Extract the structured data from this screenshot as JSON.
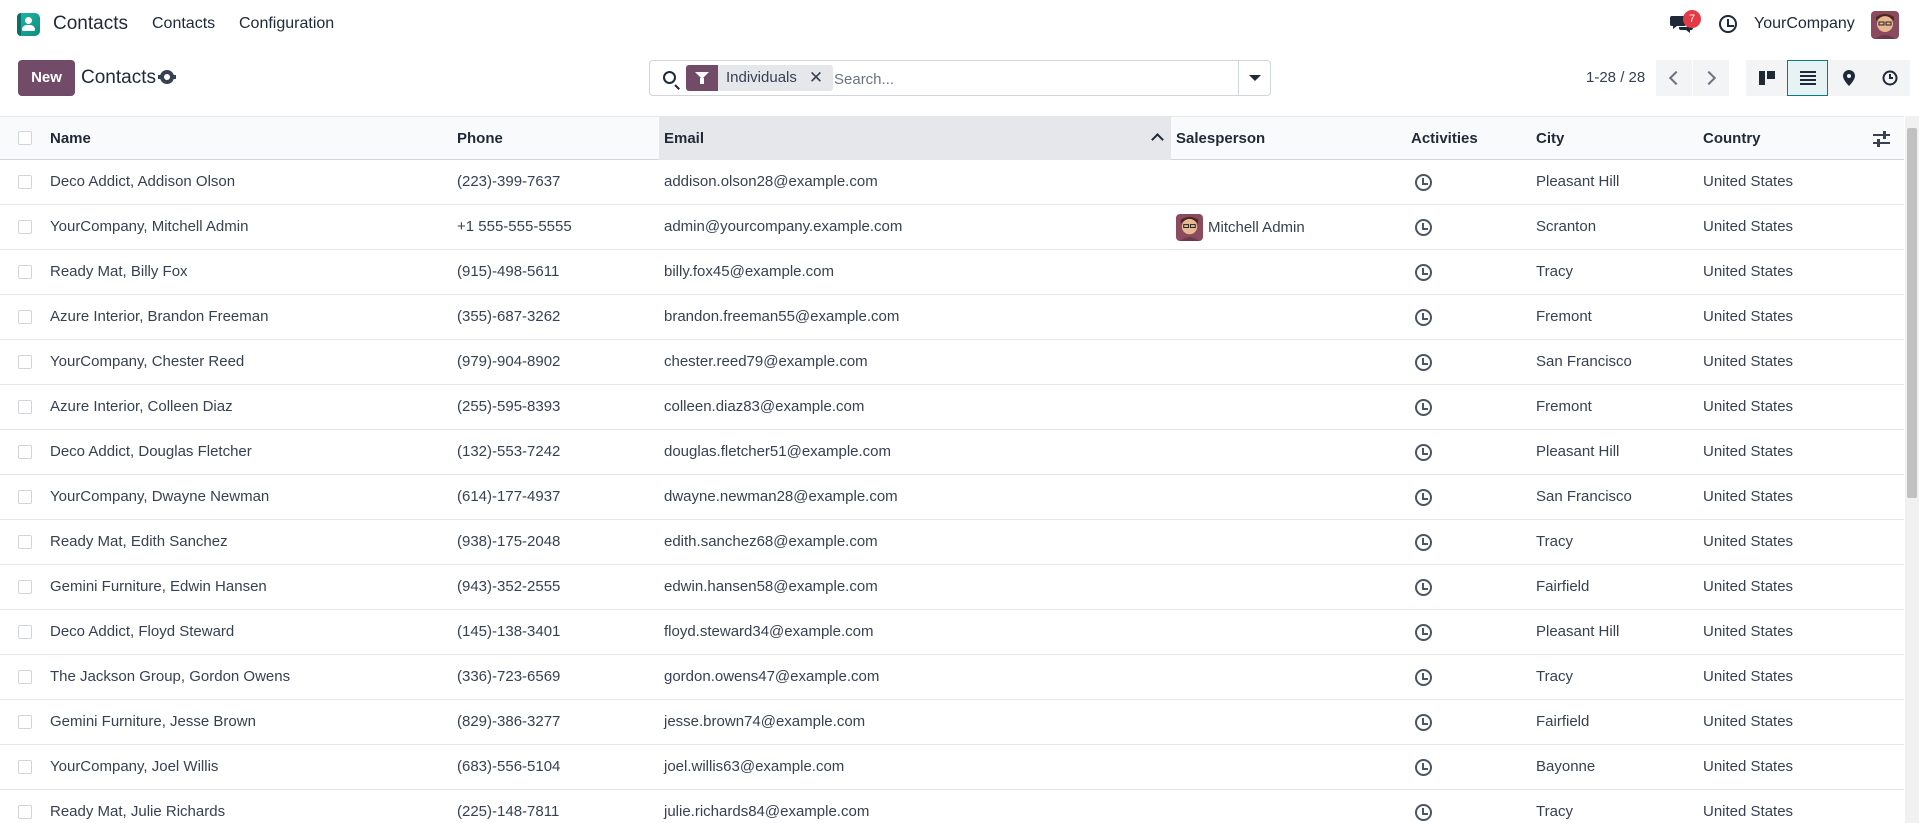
{
  "navbar": {
    "app_name": "Contacts",
    "menu": [
      "Contacts",
      "Configuration"
    ],
    "message_count": "7",
    "company": "YourCompany"
  },
  "control_panel": {
    "new_label": "New",
    "breadcrumb": "Contacts",
    "search": {
      "facet": "Individuals",
      "facet_remove": "✕",
      "placeholder": "Search...",
      "value": ""
    },
    "pager": "1-28 / 28"
  },
  "table": {
    "columns": [
      "Name",
      "Phone",
      "Email",
      "Salesperson",
      "Activities",
      "City",
      "Country"
    ],
    "rows": [
      {
        "name": "Deco Addict, Addison Olson",
        "phone": "(223)-399-7637",
        "email": "addison.olson28@example.com",
        "salesperson": "",
        "city": "Pleasant Hill",
        "country": "United States"
      },
      {
        "name": "YourCompany, Mitchell Admin",
        "phone": "+1 555-555-5555",
        "email": "admin@yourcompany.example.com",
        "salesperson": "Mitchell Admin",
        "city": "Scranton",
        "country": "United States"
      },
      {
        "name": "Ready Mat, Billy Fox",
        "phone": "(915)-498-5611",
        "email": "billy.fox45@example.com",
        "salesperson": "",
        "city": "Tracy",
        "country": "United States"
      },
      {
        "name": "Azure Interior, Brandon Freeman",
        "phone": "(355)-687-3262",
        "email": "brandon.freeman55@example.com",
        "salesperson": "",
        "city": "Fremont",
        "country": "United States"
      },
      {
        "name": "YourCompany, Chester Reed",
        "phone": "(979)-904-8902",
        "email": "chester.reed79@example.com",
        "salesperson": "",
        "city": "San Francisco",
        "country": "United States"
      },
      {
        "name": "Azure Interior, Colleen Diaz",
        "phone": "(255)-595-8393",
        "email": "colleen.diaz83@example.com",
        "salesperson": "",
        "city": "Fremont",
        "country": "United States"
      },
      {
        "name": "Deco Addict, Douglas Fletcher",
        "phone": "(132)-553-7242",
        "email": "douglas.fletcher51@example.com",
        "salesperson": "",
        "city": "Pleasant Hill",
        "country": "United States"
      },
      {
        "name": "YourCompany, Dwayne Newman",
        "phone": "(614)-177-4937",
        "email": "dwayne.newman28@example.com",
        "salesperson": "",
        "city": "San Francisco",
        "country": "United States"
      },
      {
        "name": "Ready Mat, Edith Sanchez",
        "phone": "(938)-175-2048",
        "email": "edith.sanchez68@example.com",
        "salesperson": "",
        "city": "Tracy",
        "country": "United States"
      },
      {
        "name": "Gemini Furniture, Edwin Hansen",
        "phone": "(943)-352-2555",
        "email": "edwin.hansen58@example.com",
        "salesperson": "",
        "city": "Fairfield",
        "country": "United States"
      },
      {
        "name": "Deco Addict, Floyd Steward",
        "phone": "(145)-138-3401",
        "email": "floyd.steward34@example.com",
        "salesperson": "",
        "city": "Pleasant Hill",
        "country": "United States"
      },
      {
        "name": "The Jackson Group, Gordon Owens",
        "phone": "(336)-723-6569",
        "email": "gordon.owens47@example.com",
        "salesperson": "",
        "city": "Tracy",
        "country": "United States"
      },
      {
        "name": "Gemini Furniture, Jesse Brown",
        "phone": "(829)-386-3277",
        "email": "jesse.brown74@example.com",
        "salesperson": "",
        "city": "Fairfield",
        "country": "United States"
      },
      {
        "name": "YourCompany, Joel Willis",
        "phone": "(683)-556-5104",
        "email": "joel.willis63@example.com",
        "salesperson": "",
        "city": "Bayonne",
        "country": "United States"
      },
      {
        "name": "Ready Mat, Julie Richards",
        "phone": "(225)-148-7811",
        "email": "julie.richards84@example.com",
        "salesperson": "",
        "city": "Tracy",
        "country": "United States"
      }
    ]
  },
  "icons": {
    "app": "contacts-app-icon",
    "messages": "chat-bubbles-icon",
    "activity": "clock-icon",
    "settings": "gear-icon",
    "search": "search-icon",
    "filter": "funnel-icon",
    "dropdown": "caret-down-icon",
    "views": [
      "kanban-view-icon",
      "list-view-icon",
      "map-pin-icon",
      "clock-icon"
    ],
    "optional_columns": "sliders-icon"
  },
  "colors": {
    "primary": "#714b67",
    "active_view": "#017e84",
    "badge": "#e63946"
  }
}
